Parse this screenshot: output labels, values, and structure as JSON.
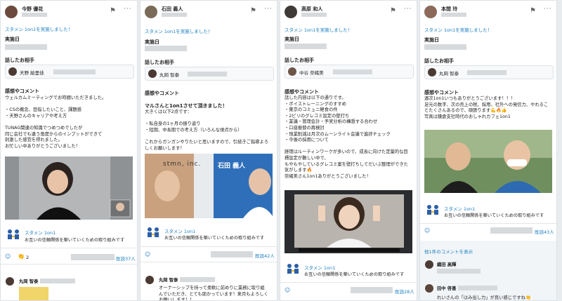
{
  "posts": [
    {
      "user": "今野 優花",
      "tag": "スタメン 1on1を実施しました！",
      "date_label": "実施日",
      "partner_label": "話したお相手",
      "partner": "天野 絵里佳",
      "comment_label": "感想やコメント",
      "comment_lines": "ウェルカムミーティングでお時間いただきました。\n\n・CSの概念、目指したいこと、課題感\n・天野さんのキャリアや考え方\n\nTUNAG関連の知識でつめつめでしたが\n同じ会社でも違う角度からのインプットができて\n刺激した感覚を得れました。\nお忙しい中ありがとうございました！",
      "app_title": "スタメン 1on1",
      "app_desc": "お互いの信頼関係を築いていくための取り組みです",
      "reaction_count": "2",
      "read": "既読37人",
      "commenter": "丸岡 智泰"
    },
    {
      "user": "石田 義人",
      "tag": "スタメン 1on1を実施しました！",
      "date_label": "実施日",
      "partner_label": "話したお相手",
      "partner": "丸岡 智泰",
      "comment_label": "感想やコメント",
      "comment_heading": "マルさんと1on1させて頂きました！",
      "comment_lines": "大きくは以下2点です：\n\n・私自身の1ヶ月の振り返り\n・短期、中長期での考え方（いろんな視点から）\n\nこれからガンガンやりたいと思いますので、引続きご指導よろ\nしくお願いします！",
      "photo_sign": "stmn, inc.",
      "photo_name": "石田 義人",
      "app_title": "スタメン 1on1",
      "app_desc": "お互いの信頼関係を築いていくための取り組みです",
      "read": "既読42人",
      "commenter": "丸岡 智泰",
      "comment_reply": "オーナーシップを持って柔軟に前めりに業務に取り組\nんでいただき、とても助かっています！来月もよろしく\nお願いします！！"
    },
    {
      "user": "高原 和人",
      "tag": "スタメン 1on1を実施しました！",
      "date_label": "実施日",
      "partner_label": "話したお相手",
      "partner": "中谷 奈緒美",
      "comment_label": "感想やコメント",
      "comment_lines": "話した内容は以下の通りです。\n・ポイストレーニングのすすめ\n・東京のコミュニ軽食の件\n・2ピリのグレコミ設定の壁打ち\n・業議・管理会計・予実分析の構想する合わせ\n・口座振替の再検討\n・残業削減は月次のムーンライト会議で進捗チェック\n・今後の採用について\n\n経理はルーティンワークが多いので、成長に向けた定量的な目\n標設定が難しい中で、\nもやもやしているグレコミ案を壁打ちしてだいぶ整理ができた\n気がします🔥\n奈緒美さん1on1ありがとうございました！",
      "app_title": "スタメン 1on1",
      "app_desc": "お互いの信頼関係を築いていくための取り組みです",
      "read": "既読28人"
    },
    {
      "user": "本間 玲",
      "tag": "スタメン 1on1を実施しました！",
      "date_label": "実施日",
      "partner_label": "話したお相手",
      "partner": "丸岡 智泰",
      "comment_label": "感想やコメント",
      "comment_lines": "週次1on1いつもありがとうございます！！！\n足元の数字、次の売上の税、採用、社外への発信力、やれるこ\nとたくさんあるので、頑張ります💪🔥👍\n写真は鎌倉支社時代のおしゃれカフェ1on1",
      "app_title": "スタメン 1on1",
      "app_desc": "お互いの信頼関係を築いていくための取り組みです",
      "read": "既読43人",
      "more_comments": "他1件のコメントを表示",
      "commenters": [
        "織田 高輝",
        "田中 啓喜"
      ],
      "comment_reply": "れいさんの「はみ出し力」が良い感じですね👏"
    }
  ],
  "colors": {
    "accent": "#1a7fc1",
    "placeholder": "#d7dadd"
  }
}
